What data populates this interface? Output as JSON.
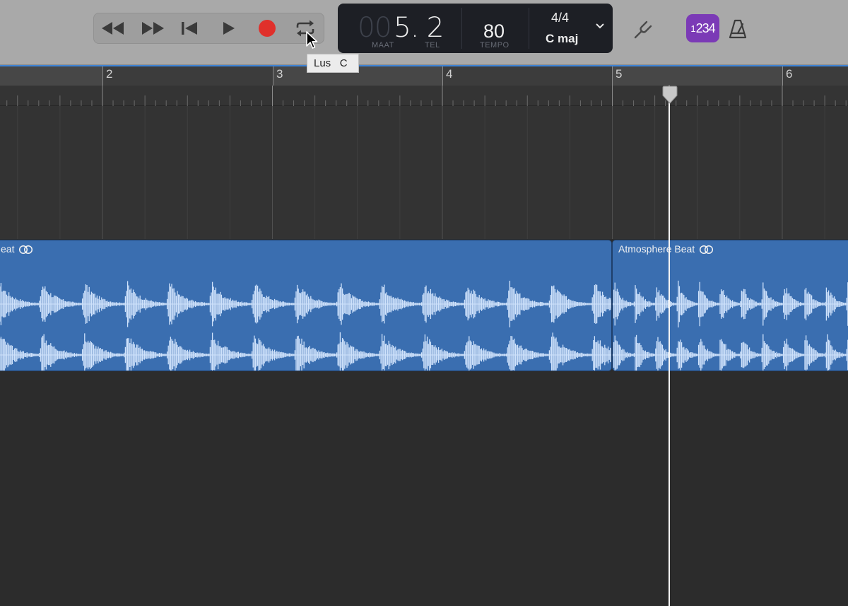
{
  "transport": {
    "rewind_icon": "rewind-icon",
    "forward_icon": "fast-forward-icon",
    "to_start_icon": "go-to-beginning-icon",
    "play_icon": "play-icon",
    "record_icon": "record-icon",
    "loop_icon": "cycle-icon",
    "record_color": "#e0302b"
  },
  "lcd": {
    "position_dim": "00",
    "position": "5. 2",
    "bar_caption": "MAAT",
    "beat_caption": "TEL",
    "tempo": "80",
    "tempo_caption": "TEMPO",
    "signature": "4/4",
    "key": "C maj"
  },
  "tools": {
    "tuner_icon": "tuning-fork-icon",
    "countin_small": "1",
    "countin_big": "234",
    "countin_color": "#7b3ab6",
    "metronome_icon": "metronome-icon"
  },
  "tooltip": {
    "label": "Lus",
    "shortcut": "C"
  },
  "ruler": {
    "bars": [
      "2",
      "3",
      "4",
      "5",
      "6"
    ]
  },
  "regions": [
    {
      "title": "eat",
      "color": "#3a6eb0"
    },
    {
      "title": "Atmosphere Beat",
      "color": "#3a6eb0"
    }
  ]
}
